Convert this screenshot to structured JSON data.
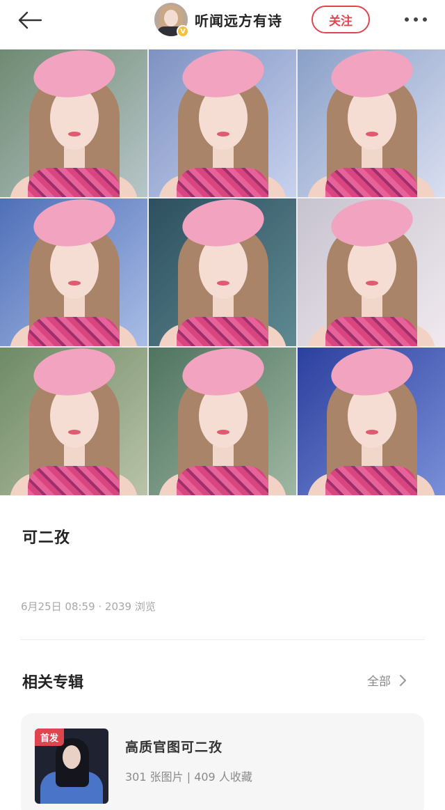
{
  "header": {
    "back_icon": "arrow-left-icon",
    "username": "听闻远方有诗",
    "verified_badge": "V",
    "follow_label": "关注",
    "more_icon": "more-dots-icon"
  },
  "colors": {
    "accent": "#e0454f",
    "meta_text": "#a8a8a8",
    "card_bg": "#f6f6f6"
  },
  "gallery": {
    "photos": [
      {
        "label": "photo-1",
        "bg": "linear-gradient(135deg,#6f8a72,#b7c6c9)"
      },
      {
        "label": "photo-2",
        "bg": "linear-gradient(135deg,#7e92c2,#c8d2ee)"
      },
      {
        "label": "photo-3",
        "bg": "linear-gradient(135deg,#8aa0c8,#d9def0)"
      },
      {
        "label": "photo-4",
        "bg": "linear-gradient(135deg,#4f6fb8,#a9bde6)"
      },
      {
        "label": "photo-5",
        "bg": "linear-gradient(135deg,#2d4f5f,#5f8a92)"
      },
      {
        "label": "photo-6",
        "bg": "linear-gradient(135deg,#c7c3cf,#f0e9ef)"
      },
      {
        "label": "photo-7",
        "bg": "linear-gradient(135deg,#6e8a66,#b9c3a8)"
      },
      {
        "label": "photo-8",
        "bg": "linear-gradient(135deg,#4f7460,#9fb7a2)"
      },
      {
        "label": "photo-9",
        "bg": "linear-gradient(135deg,#2b3f9e,#7a8fd8)"
      }
    ]
  },
  "post": {
    "title": "可二孜",
    "meta": "6月25日 08:59 · 2039 浏览"
  },
  "related": {
    "section_title": "相关专辑",
    "see_all_label": "全部",
    "album": {
      "badge": "首发",
      "name": "高质官图可二孜",
      "stats": "301 张图片 | 409 人收藏"
    }
  }
}
